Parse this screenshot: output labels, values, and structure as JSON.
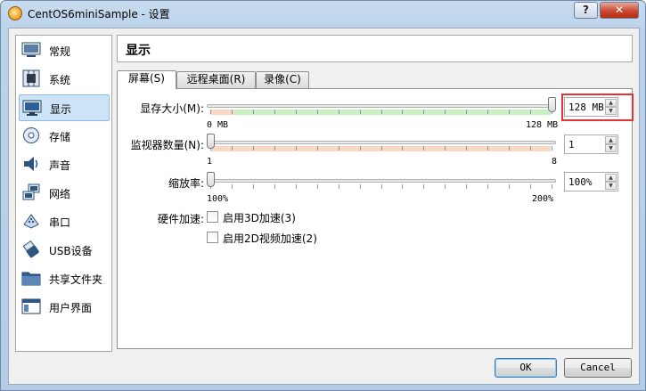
{
  "window": {
    "title": "CentOS6miniSample - 设置",
    "help_label": "?",
    "close_label": "✕"
  },
  "sidebar": {
    "items": [
      {
        "label": "常规",
        "icon": "general-icon"
      },
      {
        "label": "系统",
        "icon": "system-icon"
      },
      {
        "label": "显示",
        "icon": "display-icon",
        "selected": true
      },
      {
        "label": "存储",
        "icon": "storage-icon"
      },
      {
        "label": "声音",
        "icon": "audio-icon"
      },
      {
        "label": "网络",
        "icon": "network-icon"
      },
      {
        "label": "串口",
        "icon": "serial-port-icon"
      },
      {
        "label": "USB设备",
        "icon": "usb-icon"
      },
      {
        "label": "共享文件夹",
        "icon": "shared-folder-icon"
      },
      {
        "label": "用户界面",
        "icon": "user-interface-icon"
      }
    ]
  },
  "header": {
    "title": "显示"
  },
  "tabs": [
    {
      "label": "屏幕(S)",
      "active": true
    },
    {
      "label": "远程桌面(R)",
      "active": false
    },
    {
      "label": "录像(C)",
      "active": false
    }
  ],
  "screen": {
    "video_memory": {
      "label": "显存大小(M):",
      "min_label": "0 MB",
      "max_label": "128 MB",
      "value": "128 MB",
      "fraction": 1.0
    },
    "monitor_count": {
      "label": "监视器数量(N):",
      "min_label": "1",
      "max_label": "8",
      "value": "1",
      "fraction": 0.0
    },
    "scale_factor": {
      "label": "缩放率:",
      "min_label": "100%",
      "max_label": "200%",
      "value": "100%",
      "fraction": 0.0
    },
    "acceleration": {
      "label": "硬件加速:",
      "enable_3d": {
        "label": "启用3D加速(3)",
        "checked": false
      },
      "enable_2d": {
        "label": "启用2D视频加速(2)",
        "checked": false
      }
    }
  },
  "buttons": {
    "ok": "OK",
    "cancel": "Cancel"
  },
  "colors": {
    "selection": "#cde4f8",
    "green_band": "#c9f0c0",
    "orange_band": "#f8d7c4",
    "highlight": "#e53333"
  }
}
